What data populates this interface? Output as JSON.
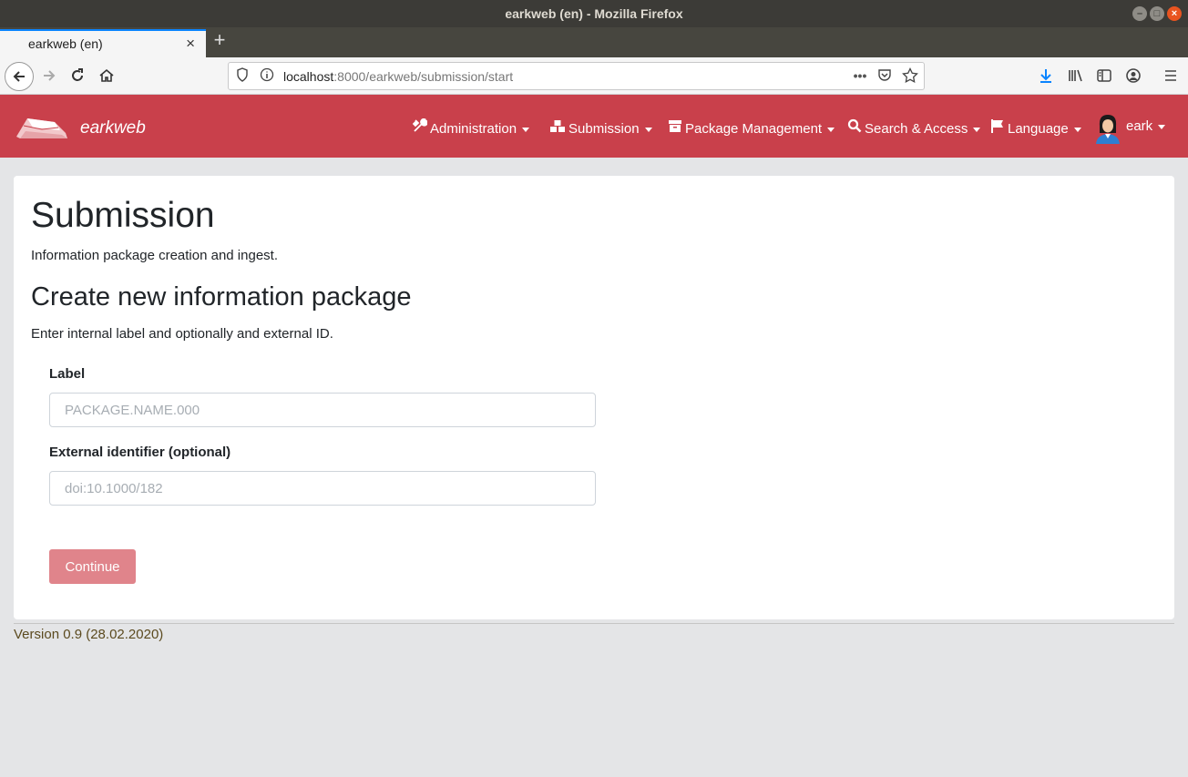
{
  "window": {
    "title": "earkweb (en) - Mozilla Firefox",
    "minimize_glyph": "–",
    "maximize_glyph": "□",
    "close_glyph": "×"
  },
  "tabs": [
    {
      "label": "earkweb (en)",
      "close_glyph": "×",
      "active": true
    }
  ],
  "new_tab_glyph": "+",
  "toolbar": {
    "url_host": "localhost",
    "url_path": ":8000/earkweb/submission/start",
    "back_icon": "arrow-left-icon",
    "forward_icon": "arrow-right-icon",
    "reload_icon": "reload-icon",
    "home_icon": "home-icon",
    "icons": [
      "shield-icon",
      "info-icon",
      "more-icon",
      "pocket-icon",
      "bookmark-star-icon",
      "download-icon",
      "library-icon",
      "sidebar-icon",
      "account-icon",
      "hamburger-menu-icon"
    ],
    "accent_color": "#0a84ff"
  },
  "app": {
    "brand": "earkweb",
    "brand_color": "#c9404b",
    "menu": [
      {
        "label": "Administration",
        "icon": "tools-icon"
      },
      {
        "label": "Submission",
        "icon": "boxes-icon"
      },
      {
        "label": "Package Management",
        "icon": "archive-icon"
      },
      {
        "label": "Search & Access",
        "icon": "search-icon"
      },
      {
        "label": "Language",
        "icon": "flag-icon"
      }
    ],
    "user": {
      "name": "eark",
      "icon": "user-avatar-icon"
    }
  },
  "page": {
    "title": "Submission",
    "subtitle": "Information package creation and ingest.",
    "section_title": "Create new information package",
    "section_desc": "Enter internal label and optionally and external ID.",
    "form": {
      "label_field": {
        "label": "Label",
        "value": "",
        "placeholder": "PACKAGE.NAME.000"
      },
      "external_id_field": {
        "label": "External identifier (optional)",
        "value": "",
        "placeholder": "doi:10.1000/182"
      },
      "continue_label": "Continue",
      "continue_color": "#e0848b"
    }
  },
  "footer": {
    "version": "Version 0.9 (28.02.2020)"
  }
}
